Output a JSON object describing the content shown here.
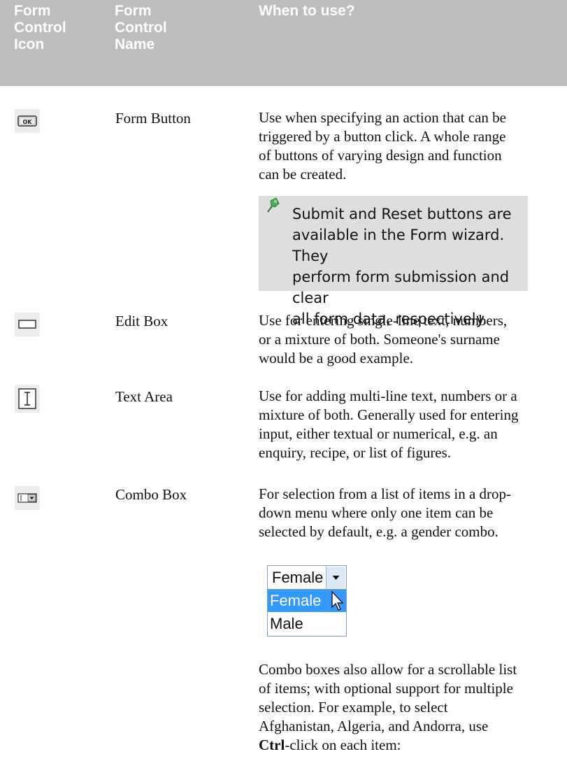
{
  "header": {
    "col1": [
      "Form",
      "Control",
      "Icon"
    ],
    "col2": [
      "Form",
      "Control",
      "Name"
    ],
    "col3": "When to use?"
  },
  "rows": [
    {
      "icon": "ok-button-icon",
      "name": "Form Button",
      "description": [
        "Use when specifying an action that can be",
        "triggered by a button click. A whole range",
        "of buttons of varying design and function",
        "can be created."
      ]
    },
    {
      "icon": "edit-box-icon",
      "name": "Edit Box",
      "description": [
        "Use for entering single-line text, numbers,",
        "or a mixture of both. Someone's surname",
        "would be a good example."
      ]
    },
    {
      "icon": "text-area-icon",
      "name": "Text Area",
      "description": [
        "Use for adding multi-line text, numbers or a",
        "mixture of both. Generally used for entering",
        "input, either textual or numerical, e.g. an",
        "enquiry, recipe, or list of figures."
      ]
    },
    {
      "icon": "combo-box-icon",
      "name": "Combo Box",
      "description": [
        "For selection from a list of items in a drop-",
        "down menu where only one item can be",
        "selected by default, e.g. a gender combo."
      ]
    }
  ],
  "note": {
    "icon": "pushpin-icon",
    "lines": [
      "Submit and Reset buttons are",
      "available in the Form wizard. They",
      "perform form submission and clear",
      "all form data, respectively."
    ]
  },
  "combo_example": {
    "selected_value": "Female",
    "options": [
      "Female",
      "Male"
    ],
    "highlighted_option": "Female"
  },
  "combo_followup": {
    "lines": [
      "Combo boxes also allow for a scrollable list",
      "of items; with optional support for multiple",
      "selection. For example, to select",
      "Afghanistan, Algeria, and Andorra, use"
    ],
    "last_line_bold": "Ctrl",
    "last_line_rest": "-click on each item:"
  },
  "colors": {
    "header_bg": "#bdbdbd",
    "note_bg": "#dedede",
    "selection": "#3399ff"
  }
}
